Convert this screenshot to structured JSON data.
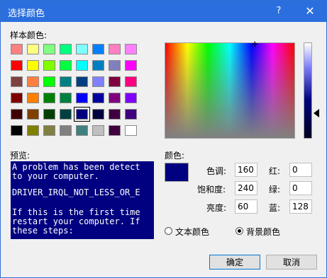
{
  "window": {
    "title": "选择颜色",
    "help": "?",
    "close": "✕"
  },
  "basic_colors_label": "样本颜色:",
  "swatches": [
    [
      "#ff8080",
      "#ffff80",
      "#80ff80",
      "#00ff80",
      "#80ffff",
      "#0080ff",
      "#ff80c0",
      "#ff80ff"
    ],
    [
      "#ff0000",
      "#ffff00",
      "#80ff00",
      "#00ff40",
      "#00ffff",
      "#0080c0",
      "#8080c0",
      "#ff00ff"
    ],
    [
      "#804040",
      "#ff8040",
      "#00ff00",
      "#008080",
      "#004080",
      "#8080ff",
      "#800040",
      "#ff0080"
    ],
    [
      "#800000",
      "#ff8000",
      "#008000",
      "#008040",
      "#0000ff",
      "#0000a0",
      "#800080",
      "#8000ff"
    ],
    [
      "#400000",
      "#804000",
      "#004000",
      "#004040",
      "#000080",
      "#000040",
      "#400040",
      "#400080"
    ],
    [
      "#000000",
      "#808000",
      "#808040",
      "#808080",
      "#408080",
      "#c0c0c0",
      "#400040",
      "#ffffff"
    ]
  ],
  "preview_label": "预览:",
  "preview_lines": [
    "A problem has been detect",
    "to your computer.",
    "",
    "DRIVER_IRQL_NOT_LESS_OR_E",
    "",
    "If this is the first time",
    "restart your computer. If",
    "these steps:"
  ],
  "color_label": "颜色:",
  "hue_label": "色调:",
  "hue_value": "160",
  "sat_label": "饱和度:",
  "sat_value": "240",
  "lum_label": "亮度:",
  "lum_value": "60",
  "red_label": "红:",
  "red_value": "0",
  "green_label": "绿:",
  "green_value": "0",
  "blue_label": "蓝:",
  "blue_value": "128",
  "radio_text": "文本颜色",
  "radio_bg": "背景颜色",
  "ok": "确定",
  "cancel": "取消",
  "current_color": "#000080"
}
